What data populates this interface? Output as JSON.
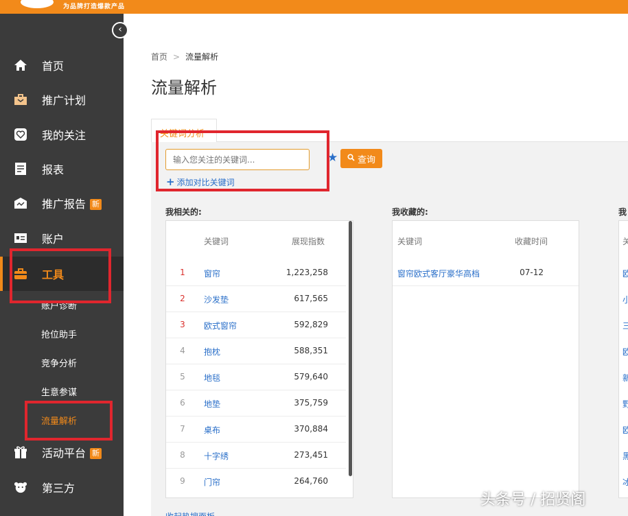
{
  "topbar": {
    "tagline": "为品牌打造爆款产品"
  },
  "nav": {
    "collapse_icon": "‹",
    "items": [
      {
        "label": "首页",
        "icon": "home-icon"
      },
      {
        "label": "推广计划",
        "icon": "briefcase-icon"
      },
      {
        "label": "我的关注",
        "icon": "heart-icon"
      },
      {
        "label": "报表",
        "icon": "report-icon"
      },
      {
        "label": "推广报告",
        "badge": "新",
        "icon": "report-shop-icon"
      },
      {
        "label": "账户",
        "icon": "account-card-icon"
      },
      {
        "label": "工具",
        "icon": "toolbox-icon"
      },
      {
        "label": "活动平台",
        "badge": "新",
        "icon": "gift-icon"
      },
      {
        "label": "第三方",
        "icon": "third-party-icon"
      }
    ],
    "sub_items": [
      "账户诊断",
      "抢位助手",
      "竞争分析",
      "生意参谋",
      "流量解析"
    ]
  },
  "breadcrumb": {
    "home": "首页",
    "current": "流量解析"
  },
  "page_title": "流量解析",
  "tab_label": "关键词分析",
  "search": {
    "placeholder": "输入您关注的关键词...",
    "query_label": "查询",
    "add_compare": "添加对比关键词"
  },
  "related": {
    "title": "我相关的:",
    "col_keyword": "关键词",
    "col_index": "展现指数",
    "rows": [
      {
        "rank": "1",
        "keyword": "窗帘",
        "index": "1,223,258"
      },
      {
        "rank": "2",
        "keyword": "沙发垫",
        "index": "617,565"
      },
      {
        "rank": "3",
        "keyword": "欧式窗帘",
        "index": "592,829"
      },
      {
        "rank": "4",
        "keyword": "抱枕",
        "index": "588,351"
      },
      {
        "rank": "5",
        "keyword": "地毯",
        "index": "579,640"
      },
      {
        "rank": "6",
        "keyword": "地垫",
        "index": "375,759"
      },
      {
        "rank": "7",
        "keyword": "桌布",
        "index": "370,884"
      },
      {
        "rank": "8",
        "keyword": "十字绣",
        "index": "273,451"
      },
      {
        "rank": "9",
        "keyword": "门帘",
        "index": "264,760"
      }
    ],
    "bottom_link": "收起热搜面板"
  },
  "favorites": {
    "title": "我收藏的:",
    "col_keyword": "关键词",
    "col_time": "收藏时间",
    "rows": [
      {
        "keyword": "窗帘欧式客厅豪华高档",
        "time": "07-12"
      }
    ]
  },
  "third_column": {
    "title_fragment": "我",
    "col_fragment": "关",
    "chars": [
      "欧",
      "小",
      "三",
      "欧",
      "新",
      "野",
      "欧",
      "黑",
      "冰"
    ]
  },
  "watermark": "头条号 / 招贤阁",
  "colors": {
    "accent": "#f28a1a",
    "sidebar": "#3b3b3b",
    "link": "#2a6fc9",
    "annotation": "#e0262e"
  }
}
